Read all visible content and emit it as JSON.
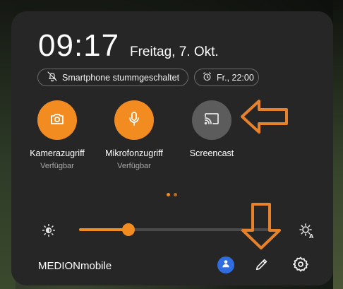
{
  "header": {
    "time": "09:17",
    "date": "Freitag, 7. Okt."
  },
  "chips": {
    "mute": {
      "label": "Smartphone stummgeschaltet",
      "icon": "bell-off-icon"
    },
    "alarm": {
      "label": "Fr., 22:00",
      "icon": "alarm-clock-icon"
    }
  },
  "tiles": [
    {
      "label": "Kamerazugriff",
      "sublabel": "Verfügbar",
      "icon": "camera-icon",
      "state": "on"
    },
    {
      "label": "Mikrofonzugriff",
      "sublabel": "Verfügbar",
      "icon": "microphone-icon",
      "state": "on"
    },
    {
      "label": "Screencast",
      "sublabel": "",
      "icon": "cast-icon",
      "state": "off"
    }
  ],
  "pager": {
    "pages": 2,
    "current": 1
  },
  "brightness": {
    "level": 0.26,
    "low_icon": "brightness-low-icon",
    "auto_icon": "brightness-auto-icon"
  },
  "footer": {
    "carrier": "MEDIONmobile",
    "user_icon": "user-icon",
    "edit_icon": "pencil-icon",
    "settings_icon": "gear-icon"
  },
  "colors": {
    "accent": "#f28b20",
    "panel": "#262626",
    "tile_off": "#5c5c5c",
    "user_blue": "#2f6de0",
    "annotation_arrow": "#e8822a"
  }
}
